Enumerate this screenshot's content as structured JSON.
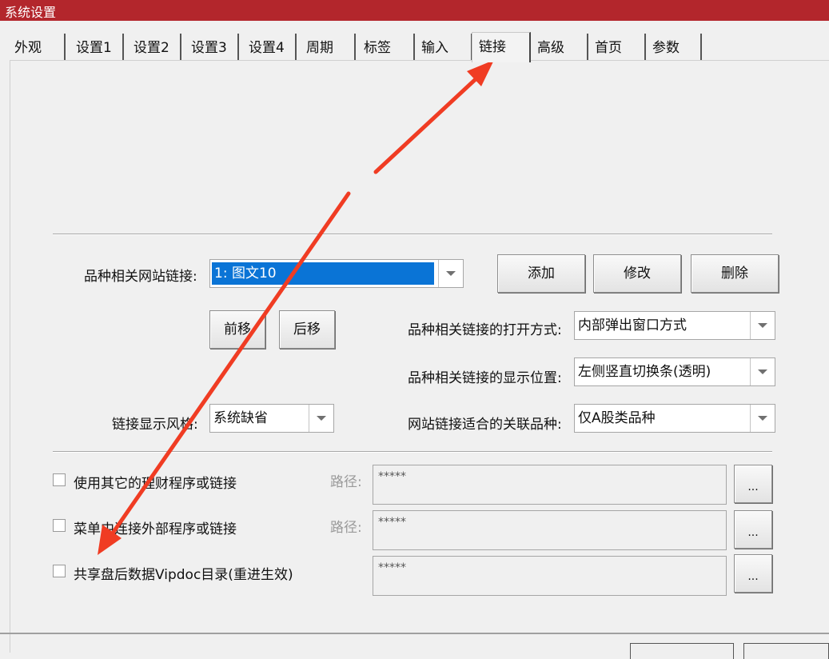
{
  "window": {
    "title": "系统设置"
  },
  "tabs": [
    {
      "label": "外观"
    },
    {
      "label": "设置1"
    },
    {
      "label": "设置2"
    },
    {
      "label": "设置3"
    },
    {
      "label": "设置4"
    },
    {
      "label": "周期"
    },
    {
      "label": "标签"
    },
    {
      "label": "输入"
    },
    {
      "label": "链接",
      "active": true
    },
    {
      "label": "高级"
    },
    {
      "label": "首页"
    },
    {
      "label": "参数"
    }
  ],
  "links": {
    "site_link_label": "品种相关网站链接:",
    "site_link_value": "1: 图文10",
    "add_button": "添加",
    "modify_button": "修改",
    "delete_button": "删除",
    "move_up_button": "前移",
    "move_down_button": "后移",
    "open_mode_label": "品种相关链接的打开方式:",
    "open_mode_value": "内部弹出窗口方式",
    "display_position_label": "品种相关链接的显示位置:",
    "display_position_value": "左侧竖直切换条(透明)",
    "style_label": "链接显示风格:",
    "style_value": "系统缺省",
    "related_type_label": "网站链接适合的关联品种:",
    "related_type_value": "仅A股类品种"
  },
  "options": {
    "other_program_label": "使用其它的理财程序或链接",
    "menu_link_label": "菜单中连接外部程序或链接",
    "share_vipdoc_label": "共享盘后数据Vipdoc目录(重进生效)",
    "path_label": "路径:",
    "path_placeholder": "*****",
    "browse_button": "..."
  },
  "annotation": {
    "arrow_color": "#f03c23"
  }
}
